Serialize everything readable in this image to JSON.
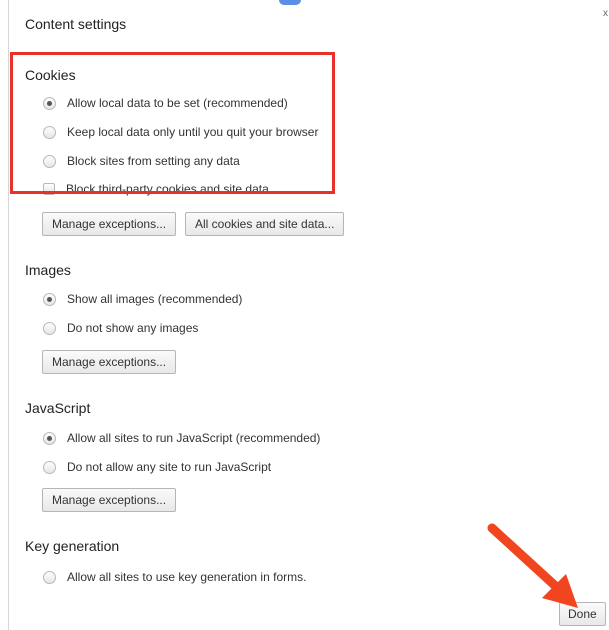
{
  "dialog": {
    "title": "Content settings",
    "close_symbol": "x"
  },
  "cookies": {
    "title": "Cookies",
    "options": [
      {
        "label": "Allow local data to be set (recommended)",
        "checked": true
      },
      {
        "label": "Keep local data only until you quit your browser",
        "checked": false
      },
      {
        "label": "Block sites from setting any data",
        "checked": false
      }
    ],
    "checkbox_label": "Block third-party cookies and site data",
    "checkbox_checked": false,
    "manage_exceptions_label": "Manage exceptions...",
    "all_cookies_label": "All cookies and site data..."
  },
  "images": {
    "title": "Images",
    "options": [
      {
        "label": "Show all images (recommended)",
        "checked": true
      },
      {
        "label": "Do not show any images",
        "checked": false
      }
    ],
    "manage_exceptions_label": "Manage exceptions..."
  },
  "javascript": {
    "title": "JavaScript",
    "options": [
      {
        "label": "Allow all sites to run JavaScript (recommended)",
        "checked": true
      },
      {
        "label": "Do not allow any site to run JavaScript",
        "checked": false
      }
    ],
    "manage_exceptions_label": "Manage exceptions..."
  },
  "key_generation": {
    "title": "Key generation",
    "options": [
      {
        "label": "Allow all sites to use key generation in forms.",
        "checked": false
      }
    ]
  },
  "footer": {
    "done_label": "Done"
  },
  "annotation": {
    "highlight_color": "#e8312a",
    "arrow_color": "#f0451f"
  }
}
